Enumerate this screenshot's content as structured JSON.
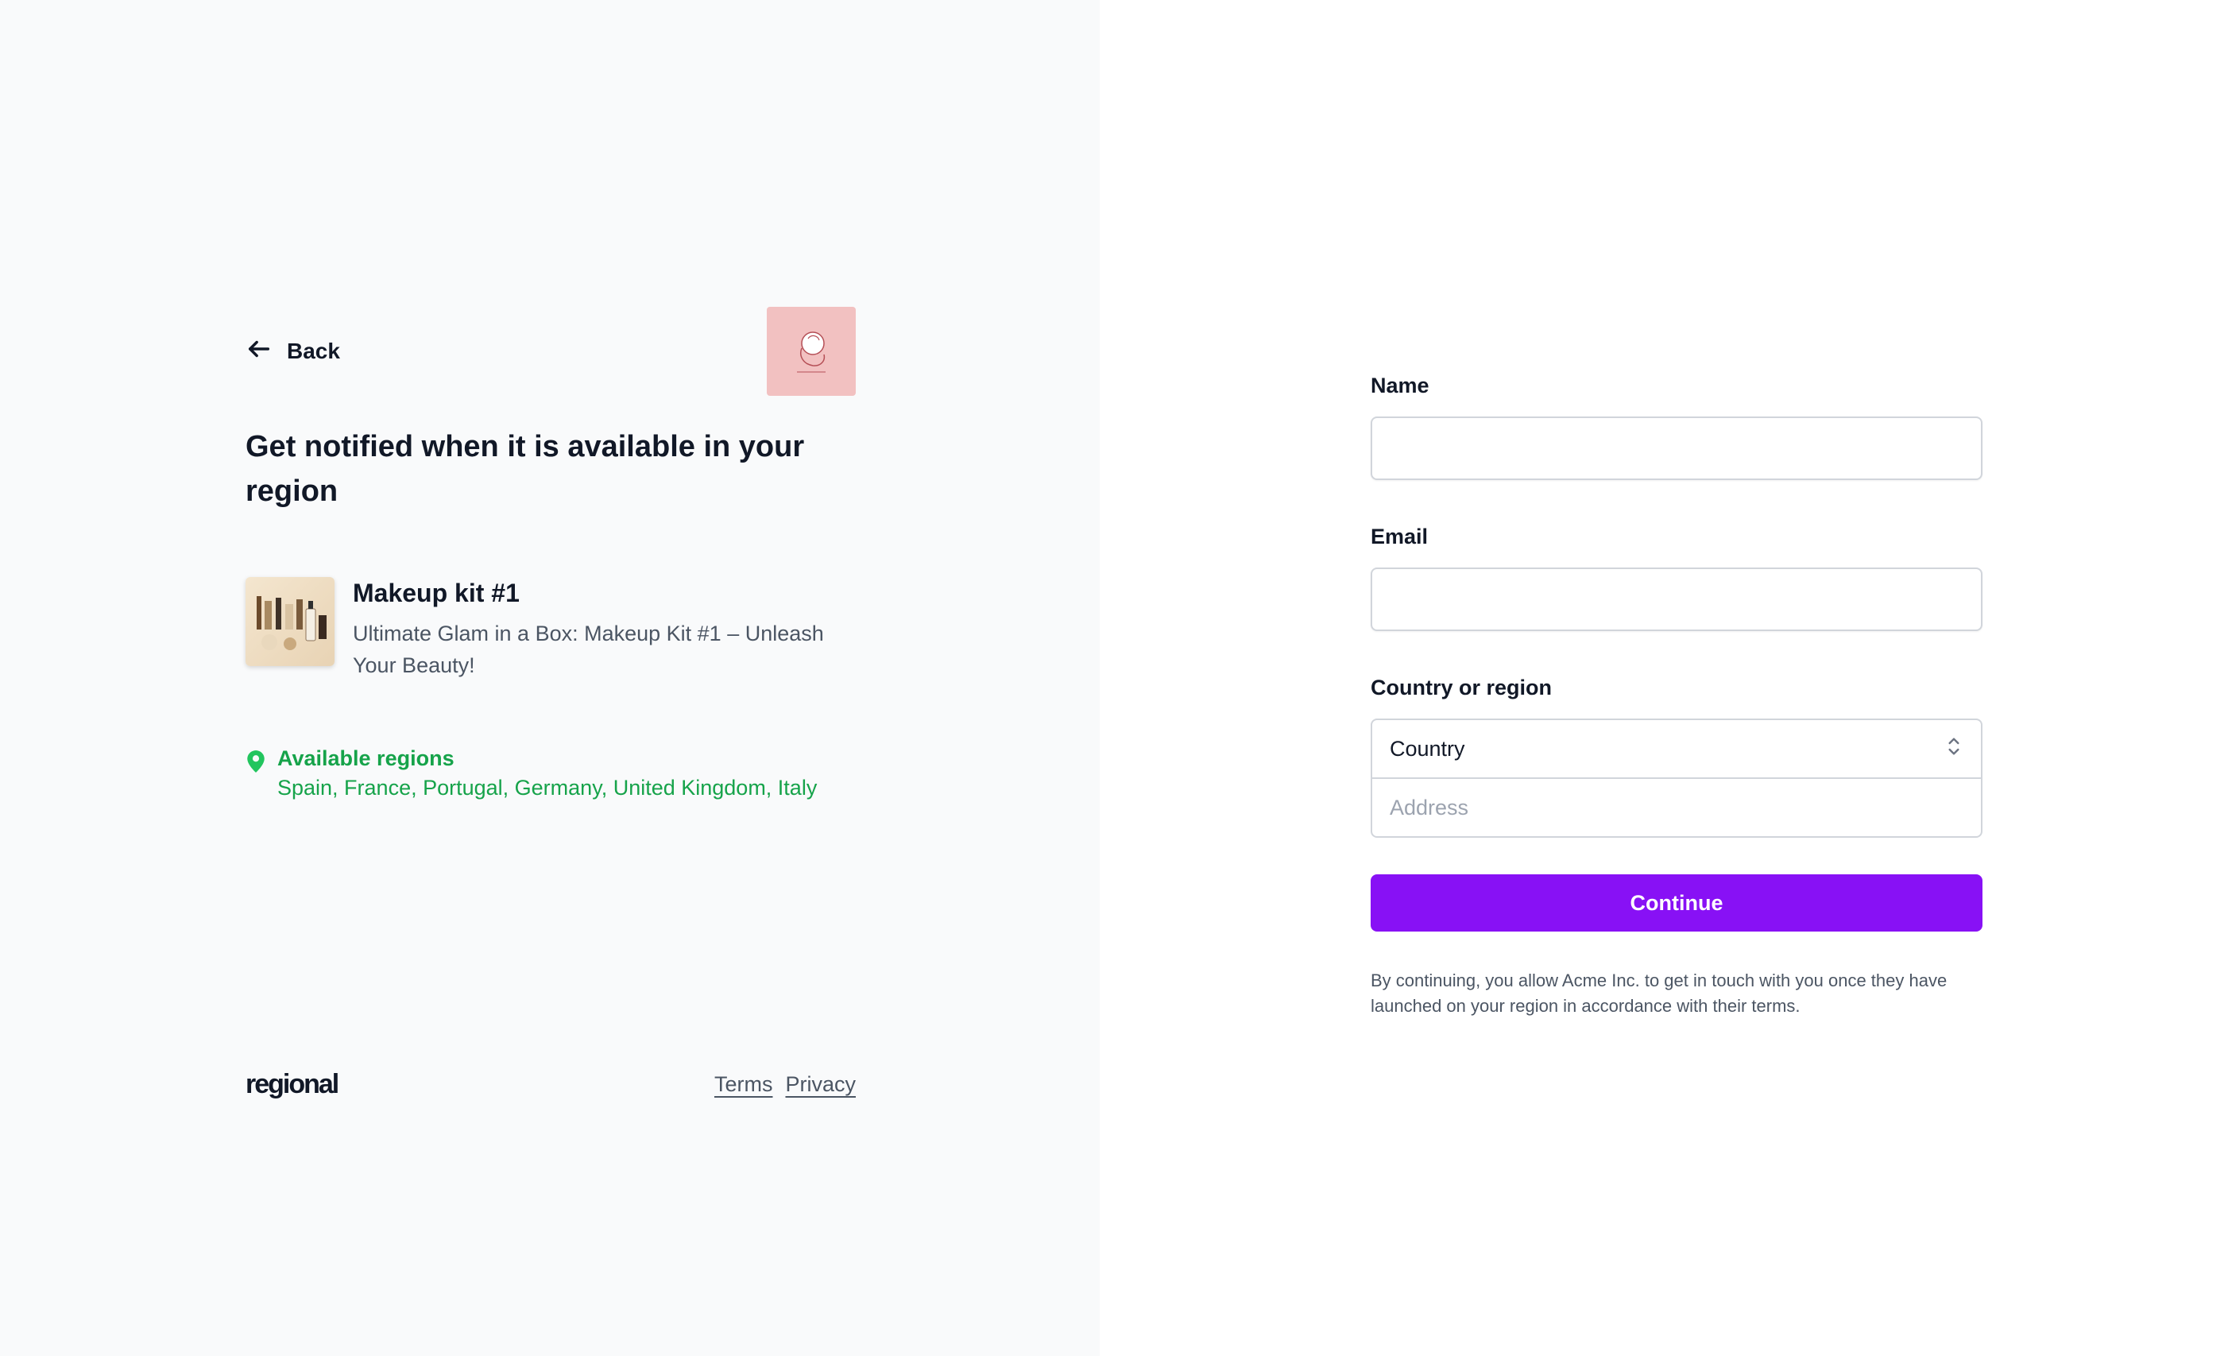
{
  "left": {
    "back_label": "Back",
    "headline": "Get notified when it is available in your region",
    "product": {
      "name": "Makeup kit #1",
      "description": "Ultimate Glam in a Box: Makeup Kit #1 – Unleash Your Beauty!"
    },
    "regions": {
      "title": "Available regions",
      "list": "Spain, France, Portugal, Germany, United Kingdom, Italy"
    },
    "footer": {
      "logo": "regional",
      "terms": "Terms",
      "privacy": "Privacy"
    }
  },
  "form": {
    "name_label": "Name",
    "name_value": "",
    "email_label": "Email",
    "email_value": "",
    "country_label": "Country or region",
    "country_selected": "Country",
    "address_placeholder": "Address",
    "continue_label": "Continue",
    "disclaimer": "By continuing, you allow Acme Inc. to get in touch with you once they have launched on your region in accordance with their terms."
  },
  "colors": {
    "accent": "#8811f5",
    "success": "#16a34a",
    "brand_logo_bg": "#f2c1c1",
    "left_bg": "#f9fafb"
  },
  "icons": {
    "back": "arrow-left-icon",
    "location": "map-pin-icon",
    "select": "chevron-up-down-icon"
  }
}
